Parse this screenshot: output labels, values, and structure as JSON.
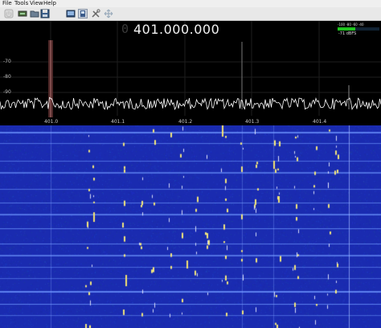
{
  "menu": {
    "items": [
      "File",
      "Tools",
      "View",
      "Help"
    ]
  },
  "toolbar": {
    "buttons": [
      {
        "name": "start-stop-icon",
        "state": "disabled"
      },
      {
        "name": "input-device-icon"
      },
      {
        "name": "open-folder-icon"
      },
      {
        "name": "save-icon"
      },
      {
        "name": "remote-control-icon"
      },
      {
        "name": "fft-settings-icon",
        "state": "active"
      },
      {
        "name": "tools-icon"
      },
      {
        "name": "auto-adjust-icon"
      }
    ]
  },
  "receiver": {
    "frequency_zero": "0",
    "frequency": "401.000.000"
  },
  "smeter": {
    "scale": "-100  -80  -60  -40",
    "readout": "-71 dBFS",
    "level_dbfs": -71,
    "color": "#1ec31e"
  },
  "spectrum": {
    "db_labels": [
      "-70",
      "-80",
      "-90"
    ],
    "freq_labels": [
      "401.0",
      "401.1",
      "401.2",
      "401.3",
      "401.4"
    ],
    "noise_color": "#ffffff",
    "marker_color": "#8a4a4a"
  },
  "waterfall": {
    "background": "#1a2bb0"
  }
}
